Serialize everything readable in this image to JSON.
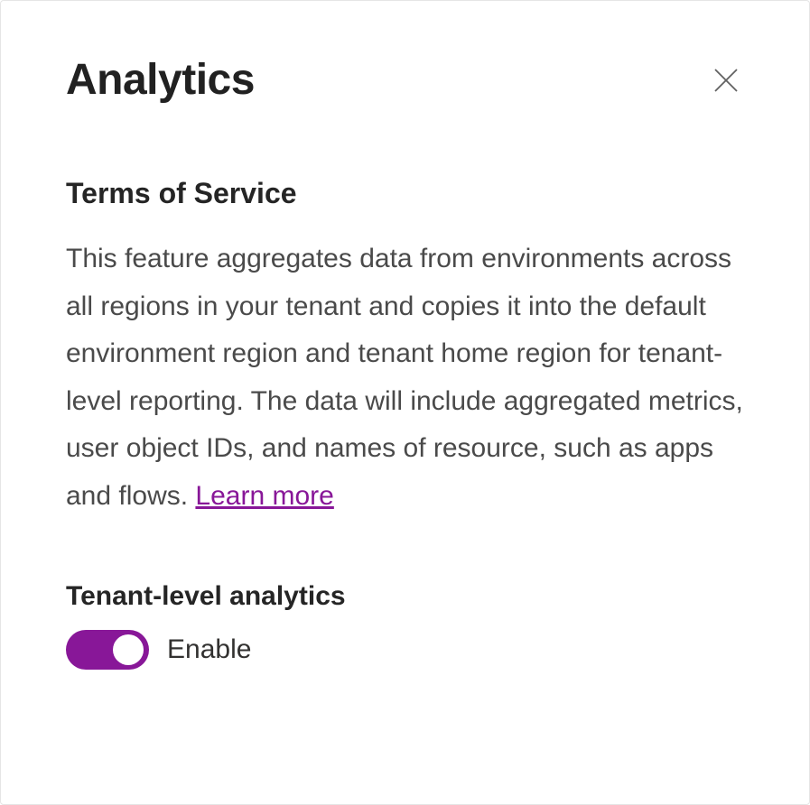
{
  "panel": {
    "title": "Analytics"
  },
  "terms": {
    "heading": "Terms of Service",
    "body": "This feature aggregates data from environments across all regions in your tenant and copies it into the default environment region and tenant home region for tenant-level reporting. The data will include aggregated metrics, user object IDs, and names of resource, such as apps and flows. ",
    "learn_more": "Learn more"
  },
  "toggle": {
    "heading": "Tenant-level analytics",
    "label": "Enable",
    "enabled": true
  },
  "colors": {
    "accent": "#881798"
  }
}
